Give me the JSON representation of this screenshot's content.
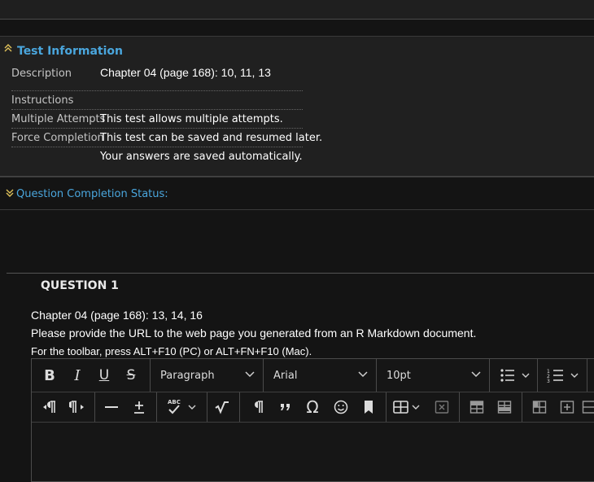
{
  "test_info": {
    "title": "Test Information",
    "rows": {
      "description": {
        "label": "Description",
        "value": "Chapter 04 (page  168): 10, 11, 13"
      },
      "instructions": {
        "label": "Instructions",
        "value": ""
      },
      "multiple_attempts": {
        "label": "Multiple Attempts",
        "value": "This test allows multiple attempts."
      },
      "force_completion": {
        "label": "Force Completion",
        "value": "This test can be saved and resumed later."
      },
      "autosave": {
        "label": "",
        "value": "Your answers are saved automatically."
      }
    }
  },
  "completion_status": {
    "label": "Question Completion Status:"
  },
  "question": {
    "number_label": "QUESTION 1",
    "line1": "Chapter 04 (page  168): 13, 14, 16",
    "line2": "Please provide the URL to the web page you generated from an R Markdown document.",
    "toolbar_hint": "For the toolbar, press ALT+F10 (PC) or ALT+FN+F10 (Mac)."
  },
  "editor": {
    "block_format": "Paragraph",
    "font_family": "Arial",
    "font_size": "10pt",
    "buttons": {
      "bold": "B",
      "italic": "I",
      "underline": "U",
      "strike": "S",
      "omega": "Ω"
    }
  },
  "icons": [
    "collapse-icon",
    "expand-icon",
    "bold-icon",
    "italic-icon",
    "underline-icon",
    "strikethrough-icon",
    "bullet-list-icon",
    "numbered-list-icon",
    "ltr-icon",
    "rtl-icon",
    "horizontal-rule-icon",
    "plus-minus-icon",
    "spellcheck-icon",
    "math-icon",
    "show-blocks-icon",
    "blockquote-icon",
    "special-char-icon",
    "emoji-icon",
    "bookmark-icon",
    "table-icon",
    "delete-table-icon"
  ],
  "colors": {
    "accent": "#4aa6dd",
    "toggle": "#e0c25a",
    "background": "#141414",
    "panel": "#202020"
  }
}
